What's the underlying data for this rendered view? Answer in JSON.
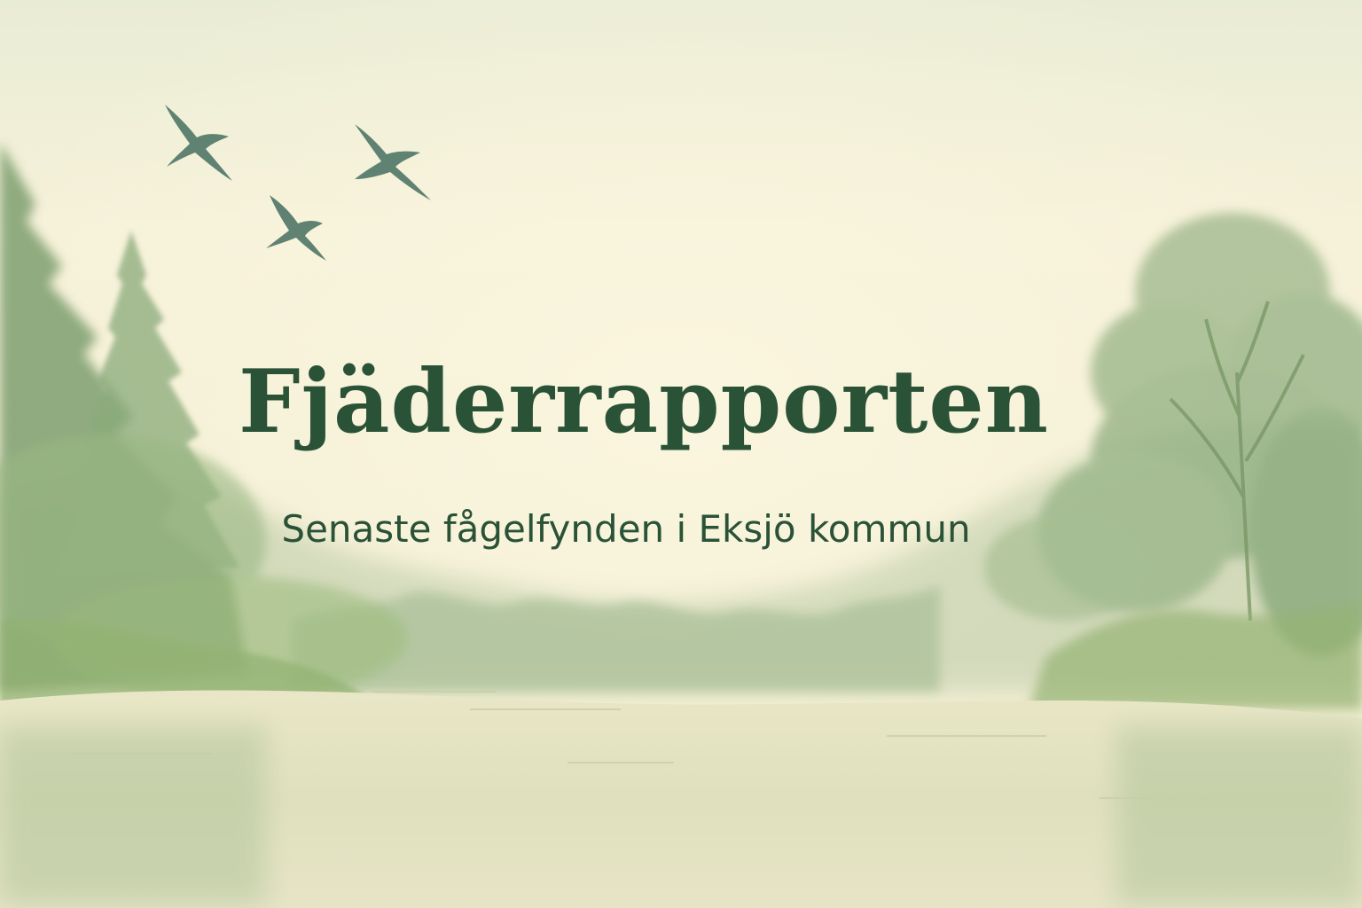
{
  "hero": {
    "title": "Fjäderrapporten",
    "subtitle": "Senaste fågelfynden i Eksjö kommun"
  },
  "illustration": {
    "style": "watercolor landscape",
    "elements": [
      "flying-bird-icon",
      "flying-bird-icon",
      "flying-bird-icon",
      "forest",
      "lake",
      "mist"
    ]
  },
  "colors": {
    "text": "#2a5237",
    "sky": "#f3efd6",
    "foliage": "#7fa06a",
    "bird": "#4f7566",
    "water": "#d9ddbb"
  }
}
